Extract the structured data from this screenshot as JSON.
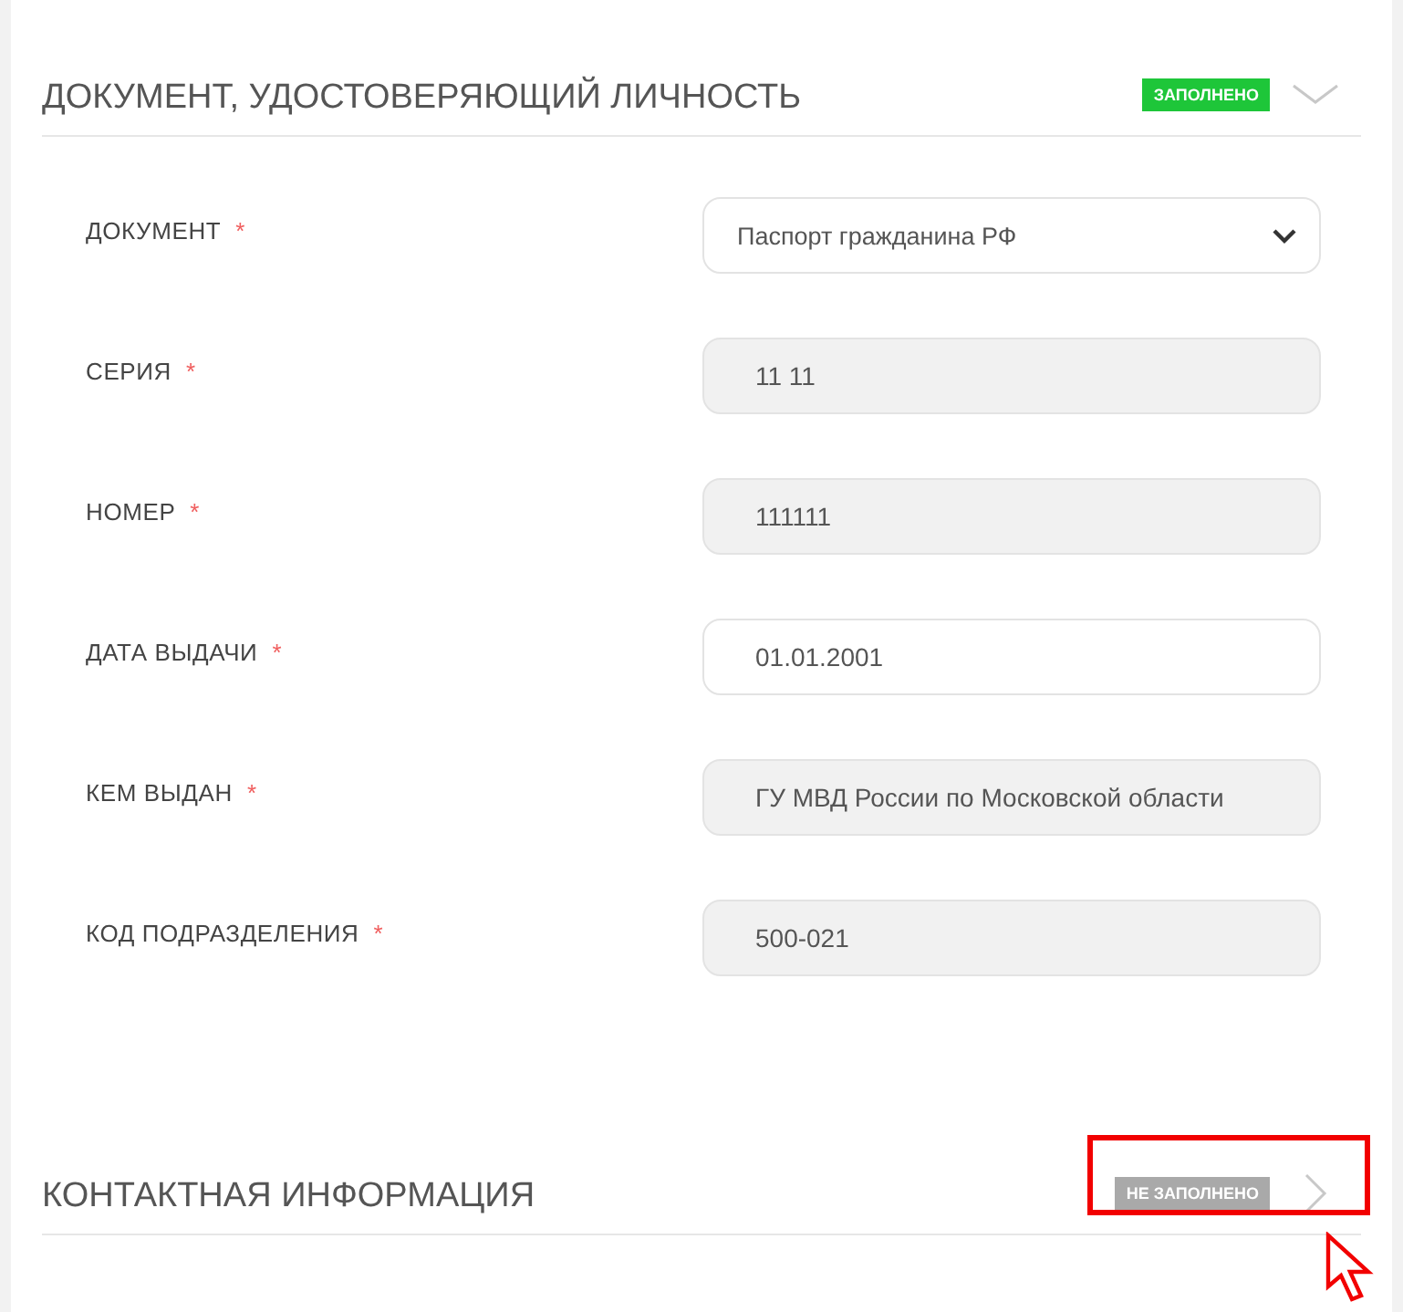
{
  "sections": [
    {
      "title": "ДОКУМЕНТ, УДОСТОВЕРЯЮЩИЙ ЛИЧНОСТЬ",
      "status": {
        "kind": "filled",
        "label": "ЗАПОЛНЕНО"
      },
      "expanded": true,
      "fields": [
        {
          "label": "ДОКУМЕНТ",
          "required_mark": "*",
          "kind": "select",
          "value": "Паспорт гражданина РФ",
          "disabled": false
        },
        {
          "label": "СЕРИЯ",
          "required_mark": "*",
          "kind": "input",
          "value": "11 11",
          "disabled": true
        },
        {
          "label": "НОМЕР",
          "required_mark": "*",
          "kind": "input",
          "value": "111111",
          "disabled": true
        },
        {
          "label": "ДАТА ВЫДАЧИ",
          "required_mark": "*",
          "kind": "input",
          "value": "01.01.2001",
          "disabled": false
        },
        {
          "label": "КЕМ ВЫДАН",
          "required_mark": "*",
          "kind": "input",
          "value": "ГУ МВД России по Московской области",
          "disabled": true
        },
        {
          "label": "КОД ПОДРАЗДЕЛЕНИЯ",
          "required_mark": "*",
          "kind": "input",
          "value": "500-021",
          "disabled": true
        }
      ]
    },
    {
      "title": "КОНТАКТНАЯ ИНФОРМАЦИЯ",
      "status": {
        "kind": "empty",
        "label": "НЕ ЗАПОЛНЕНО"
      },
      "expanded": false,
      "highlighted": true
    }
  ]
}
